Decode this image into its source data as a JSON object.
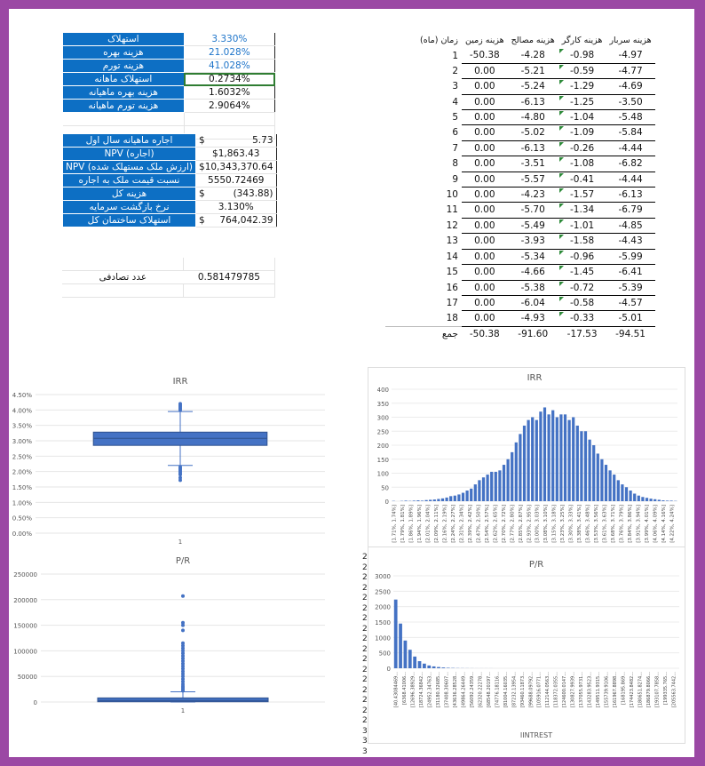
{
  "left_table": {
    "rows": [
      {
        "label": "استهلاک",
        "value": "3.330%",
        "color": "blue"
      },
      {
        "label": "هزینه بهره",
        "value": "21.028%",
        "color": "blue"
      },
      {
        "label": "هزینه تورم",
        "value": "41.028%",
        "color": "blue"
      },
      {
        "label": "استهلاک ماهانه",
        "value": "0.2734%",
        "color": "black"
      },
      {
        "label": "هزینه بهره ماهیانه",
        "value": "1.6032%",
        "color": "black"
      },
      {
        "label": "هزینه تورم ماهیانه",
        "value": "2.9064%",
        "color": "black"
      }
    ],
    "rows2": [
      {
        "label": "اجاره ماهیانه سال اول",
        "cur": "$",
        "value": "5.73"
      },
      {
        "label": "NPV (اجاره)",
        "cur": "",
        "value": "$1,863.43"
      },
      {
        "label": "NPV (ارزش ملک مستهلک شده)",
        "cur": "$",
        "value": "10,343,370.64"
      },
      {
        "label": "نسبت قیمت ملک به اجاره",
        "cur": "",
        "value": "5550.72469"
      },
      {
        "label": "هزینه کل",
        "cur": "$",
        "value": "(343.88)"
      },
      {
        "label": "نرخ بازگشت سرمایه",
        "cur": "",
        "value": "3.130%"
      },
      {
        "label": "استهلاک ساختمان کل",
        "cur": "$",
        "value": "764,042.39"
      }
    ],
    "random_label": "عدد تصادفی",
    "random_value": "0.581479785"
  },
  "right_table": {
    "headers": [
      "زمان (ماه)",
      "هزینه زمین",
      "هزینه مصالح",
      "هزینه کارگر",
      "هزینه سربار"
    ],
    "rows": [
      [
        "1",
        "-50.38",
        "-4.28",
        "-0.98",
        "-4.97"
      ],
      [
        "2",
        "0.00",
        "-5.21",
        "-0.59",
        "-4.77"
      ],
      [
        "3",
        "0.00",
        "-5.24",
        "-1.29",
        "-4.69"
      ],
      [
        "4",
        "0.00",
        "-6.13",
        "-1.25",
        "-3.50"
      ],
      [
        "5",
        "0.00",
        "-4.80",
        "-1.04",
        "-5.48"
      ],
      [
        "6",
        "0.00",
        "-5.02",
        "-1.09",
        "-5.84"
      ],
      [
        "7",
        "0.00",
        "-6.13",
        "-0.26",
        "-4.44"
      ],
      [
        "8",
        "0.00",
        "-3.51",
        "-1.08",
        "-6.82"
      ],
      [
        "9",
        "0.00",
        "-5.57",
        "-0.41",
        "-4.44"
      ],
      [
        "10",
        "0.00",
        "-4.23",
        "-1.57",
        "-6.13"
      ],
      [
        "11",
        "0.00",
        "-5.70",
        "-1.34",
        "-6.79"
      ],
      [
        "12",
        "0.00",
        "-5.49",
        "-1.01",
        "-4.85"
      ],
      [
        "13",
        "0.00",
        "-3.93",
        "-1.58",
        "-4.43"
      ],
      [
        "14",
        "0.00",
        "-5.34",
        "-0.96",
        "-5.99"
      ],
      [
        "15",
        "0.00",
        "-4.66",
        "-1.45",
        "-6.41"
      ],
      [
        "16",
        "0.00",
        "-5.38",
        "-0.72",
        "-5.39"
      ],
      [
        "17",
        "0.00",
        "-6.04",
        "-0.58",
        "-4.57"
      ],
      [
        "18",
        "0.00",
        "-4.93",
        "-0.33",
        "-5.01"
      ]
    ],
    "sum": [
      "جمع",
      "-50.38",
      "-91.60",
      "-17.53",
      "-94.51"
    ]
  },
  "chart_data": [
    {
      "type": "box",
      "title": "IRR",
      "yticks": [
        "4.50%",
        "4.00%",
        "3.50%",
        "3.00%",
        "2.50%",
        "2.00%",
        "1.50%",
        "1.00%",
        "0.50%",
        "0.00%"
      ],
      "ylim": [
        0,
        4.5
      ],
      "box": {
        "q1": 2.85,
        "median": 3.08,
        "q3": 3.28,
        "whisker_low": 2.2,
        "whisker_high": 3.95
      },
      "outliers_high": [
        4.0,
        4.05,
        4.1,
        4.15,
        4.2
      ],
      "outliers_low": [
        2.15,
        2.1,
        2.05,
        2.0,
        1.95,
        1.9,
        1.8,
        1.72
      ],
      "xlabel": "1"
    },
    {
      "type": "bar",
      "title": "IRR",
      "yticks": [
        "400",
        "350",
        "300",
        "250",
        "200",
        "150",
        "100",
        "50",
        "0"
      ],
      "ylim": [
        0,
        400
      ],
      "values": [
        1,
        0,
        1,
        2,
        1,
        2,
        3,
        2,
        4,
        5,
        6,
        8,
        10,
        13,
        18,
        20,
        24,
        30,
        38,
        45,
        60,
        75,
        85,
        95,
        105,
        105,
        110,
        130,
        150,
        175,
        210,
        240,
        270,
        290,
        300,
        290,
        320,
        335,
        310,
        325,
        300,
        310,
        310,
        290,
        300,
        270,
        250,
        250,
        220,
        200,
        170,
        150,
        130,
        110,
        95,
        75,
        60,
        50,
        38,
        27,
        20,
        15,
        12,
        9,
        7,
        5,
        3,
        2,
        2,
        1
      ],
      "categories": [
        "[1.71%, 1.74%]",
        "[1.79%, 1.81%]",
        "[1.86%, 1.89%]",
        "[1.94%, 1.96%]",
        "[2.01%, 2.04%]",
        "[2.09%, 2.11%]",
        "[2.16%, 2.19%]",
        "[2.24%, 2.27%]",
        "[2.31%, 2.34%]",
        "[2.39%, 2.42%]",
        "[2.47%, 2.50%]",
        "[2.54%, 2.57%]",
        "[2.62%, 2.65%]",
        "[2.70%, 2.72%]",
        "[2.77%, 2.80%]",
        "[2.85%, 2.87%]",
        "[2.93%, 2.95%]",
        "[3.00%, 3.03%]",
        "[3.08%, 3.10%]",
        "[3.15%, 3.18%]",
        "[3.23%, 3.25%]",
        "[3.30%, 3.33%]",
        "[3.38%, 3.41%]",
        "[3.46%, 3.48%]",
        "[3.53%, 3.56%]",
        "[3.61%, 3.63%]",
        "[3.68%, 3.71%]",
        "[3.76%, 3.79%]",
        "[3.84%, 3.86%]",
        "[3.91%, 3.94%]",
        "[3.99%, 4.01%]",
        "[4.06%, 4.09%]",
        "[4.14%, 4.16%]",
        "[4.22%, 4.24%]"
      ]
    },
    {
      "type": "box",
      "title": "P/R",
      "yticks": [
        "250000",
        "200000",
        "150000",
        "100000",
        "50000",
        "0"
      ],
      "ylim": [
        0,
        250000
      ],
      "box": {
        "q1": 500,
        "median": 3000,
        "q3": 8000,
        "whisker_low": 0,
        "whisker_high": 20000
      },
      "outliers_high": [
        22000,
        25000,
        28000,
        31000,
        35000,
        40000,
        45000,
        50000,
        55000,
        60000,
        65000,
        70000,
        75000,
        80000,
        85000,
        90000,
        95000,
        100000,
        105000,
        110000,
        115000,
        140000,
        150000,
        155000,
        207000
      ],
      "xlabel": "1"
    },
    {
      "type": "bar",
      "title": "P/R",
      "xlabel": "IINTREST",
      "yticks": [
        "3000",
        "2500",
        "2000",
        "1500",
        "1000",
        "500",
        "0"
      ],
      "ylim": [
        0,
        3000
      ],
      "values": [
        2230,
        1450,
        900,
        600,
        380,
        230,
        150,
        90,
        60,
        40,
        25,
        15,
        10,
        6,
        4,
        3,
        2,
        1,
        1,
        1,
        1,
        0,
        0,
        0,
        0,
        0,
        0,
        0,
        0,
        0,
        0,
        0,
        0,
        0,
        0,
        0,
        0,
        0,
        0,
        0,
        0,
        0,
        0,
        0,
        0,
        0,
        0,
        0,
        0,
        0,
        0,
        0,
        0,
        0,
        0,
        0,
        0,
        0,
        0,
        0
      ],
      "categories": [
        "[40.43084469...",
        "[6368.41006...",
        "[12696.38929...",
        "[18724.36842...",
        "[24952.34763...",
        "[31180.32685...",
        "[37408.30607...",
        "[43636.28528...",
        "[49864.26449...",
        "[56092.24359...",
        "[62320.22278...",
        "[68548.20197...",
        "[74776.18116...",
        "[81004.16035...",
        "[87232.13954...",
        "[93460.11873...",
        "[99688.09792...",
        "[105916.0771...",
        "[112144.0563...",
        "[118372.0355...",
        "[124600.0147...",
        "[130827.9939...",
        "[137055.9731...",
        "[143283.9523...",
        "[149511.9315...",
        "[155739.9106...",
        "[161967.8898...",
        "[168195.869...",
        "[174423.8482...",
        "[180651.8274...",
        "[186879.8066...",
        "[193107.7858...",
        "[199335.765...",
        "[205563.7442..."
      ]
    }
  ]
}
